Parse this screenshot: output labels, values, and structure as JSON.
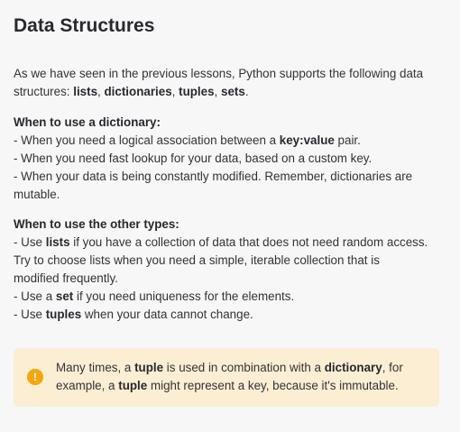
{
  "title": "Data Structures",
  "intro": {
    "line1": "As we have seen in the previous lessons, Python supports the following data",
    "line2_prefix": "structures: ",
    "kw_lists": "lists",
    "sep1": ", ",
    "kw_dicts": "dictionaries",
    "sep2": ", ",
    "kw_tuples": "tuples",
    "sep3": ", ",
    "kw_sets": "sets",
    "end": "."
  },
  "dict_section": {
    "heading": "When to use a dictionary:",
    "item1_prefix": "- When you need a logical association between a ",
    "item1_bold": "key:value",
    "item1_suffix": " pair.",
    "item2": "- When you need fast lookup for your data, based on a custom key.",
    "item3_line1": "- When your data is being constantly modified. Remember, dictionaries are",
    "item3_line2": "mutable."
  },
  "other_section": {
    "heading": "When to use the other types:",
    "item1_prefix": "- Use ",
    "item1_bold": "lists",
    "item1_suffix": " if you have a collection of data that does not need random access.",
    "item1_line2": "Try to choose lists when you need a simple, iterable collection that is",
    "item1_line3": "modified frequently.",
    "item2_prefix": "- Use a ",
    "item2_bold": "set",
    "item2_suffix": " if you need uniqueness for the elements.",
    "item3_prefix": "- Use ",
    "item3_bold": "tuples",
    "item3_suffix": " when your data cannot change."
  },
  "callout": {
    "icon": "!",
    "icon_name": "exclamation-icon",
    "icon_color": "#f4a60d",
    "background": "#fbeed3",
    "l1_a": "Many times, a ",
    "l1_b": "tuple",
    "l1_c": " is used in combination with a ",
    "l1_d": "dictionary",
    "l1_e": ", for",
    "l2_a": "example, a ",
    "l2_b": "tuple",
    "l2_c": " might represent a key, because it's immutable."
  }
}
